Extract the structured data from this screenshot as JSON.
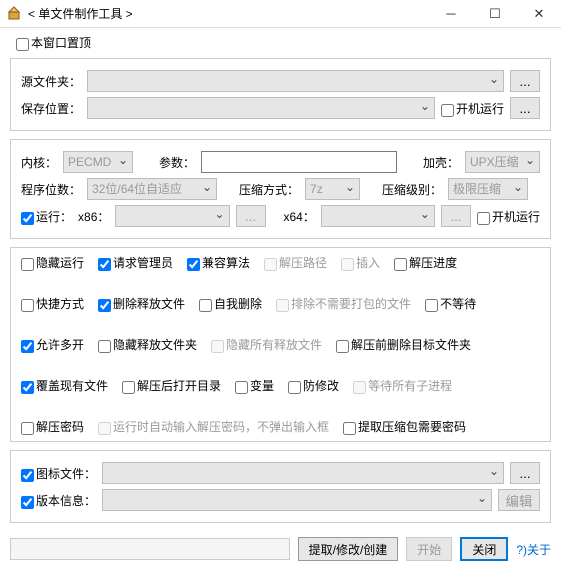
{
  "window": {
    "title": "< 单文件制作工具 >"
  },
  "top": {
    "always_on_top": "本窗口置顶"
  },
  "panel1": {
    "src_label": "源文件夹：",
    "save_label": "保存位置：",
    "boot_run": "开机运行",
    "dots": "..."
  },
  "panel2": {
    "kernel_label": "内核：",
    "kernel_value": "PECMD",
    "params_label": "参数：",
    "shell_label": "加壳：",
    "shell_value": "UPX压缩",
    "bits_label": "程序位数：",
    "bits_value": "32位/64位自适应",
    "compress_method_label": "压缩方式：",
    "compress_method_value": "7z",
    "compress_level_label": "压缩级别：",
    "compress_level_value": "极限压缩",
    "run_label": "运行：",
    "x86_label": "x86：",
    "x64_label": "x64：",
    "boot_run": "开机运行",
    "dots": "..."
  },
  "opts": {
    "hide_run": "隐藏运行",
    "request_admin": "请求管理员",
    "compat_algo": "兼容算法",
    "extract_path": "解压路径",
    "insert": "插入",
    "extract_progress": "解压进度",
    "shortcut": "快捷方式",
    "delete_release_files": "删除释放文件",
    "self_delete": "自我删除",
    "exclude_unneeded": "排除不需要打包的文件",
    "no_wait": "不等待",
    "allow_multi": "允许多开",
    "hide_release_folder": "隐藏释放文件夹",
    "hide_all_release_files": "隐藏所有释放文件",
    "delete_target_before_extract": "解压前删除目标文件夹",
    "overwrite_existing": "覆盖现有文件",
    "open_dir_after": "解压后打开目录",
    "variable": "变量",
    "anti_modify": "防修改",
    "wait_all_child": "等待所有子进程",
    "extract_password": "解压密码",
    "auto_input_pwd": "运行时自动输入解压密码，不弹出输入框",
    "extract_pkg_needs_pwd": "提取压缩包需要密码"
  },
  "panel4": {
    "icon_file": "图标文件：",
    "version_info": "版本信息：",
    "dots": "...",
    "edit": "编辑"
  },
  "bottom": {
    "extract_modify_create": "提取/修改/创建",
    "start": "开始",
    "close": "关闭",
    "about": "?)关于"
  }
}
